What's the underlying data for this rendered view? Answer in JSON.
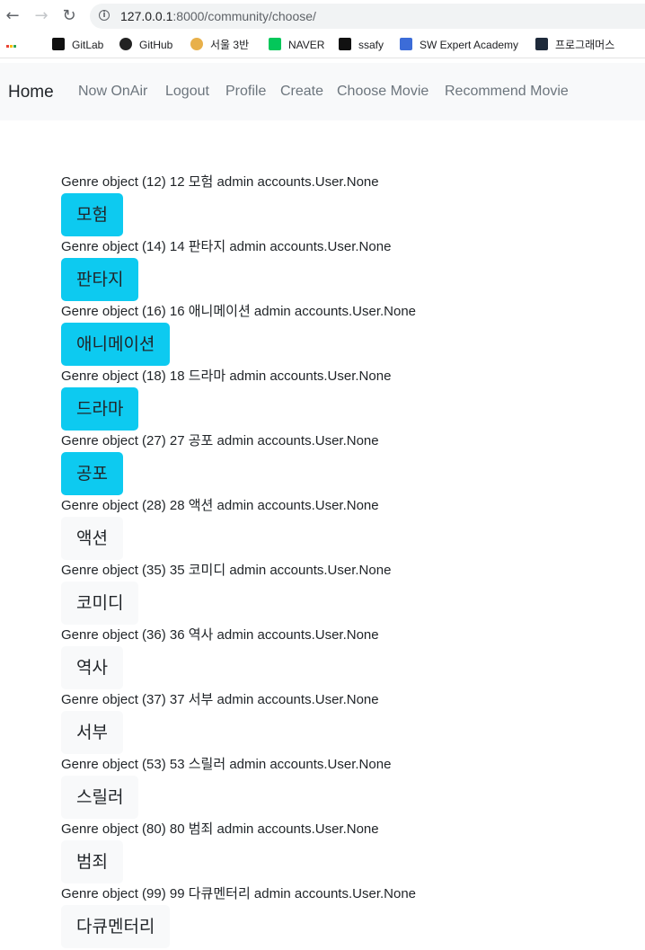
{
  "browser": {
    "url_host": "127.0.0.1",
    "url_rest": ":8000/community/choose/",
    "bookmarks": [
      {
        "label": "앱",
        "icon": "apps-icon"
      },
      {
        "label": "GitLab",
        "icon": "gitlab-icon"
      },
      {
        "label": "GitHub",
        "icon": "github-icon"
      },
      {
        "label": "서울 3반",
        "icon": "user-icon"
      },
      {
        "label": "NAVER",
        "icon": "naver-icon"
      },
      {
        "label": "ssafy",
        "icon": "ssafy-icon"
      },
      {
        "label": "SW Expert Academy",
        "icon": "swea-icon"
      },
      {
        "label": "프로그래머스",
        "icon": "programmers-icon"
      }
    ]
  },
  "navbar": {
    "brand": "Home",
    "links": [
      "Now OnAir",
      "Logout",
      "Profile",
      "Create",
      "Choose Movie",
      "Recommend Movie"
    ]
  },
  "genres": [
    {
      "text": "Genre object (12) 12 모험 admin accounts.User.None",
      "name": "모험",
      "selected": true
    },
    {
      "text": "Genre object (14) 14 판타지 admin accounts.User.None",
      "name": "판타지",
      "selected": true
    },
    {
      "text": "Genre object (16) 16 애니메이션 admin accounts.User.None",
      "name": "애니메이션",
      "selected": true
    },
    {
      "text": "Genre object (18) 18 드라마 admin accounts.User.None",
      "name": "드라마",
      "selected": true
    },
    {
      "text": "Genre object (27) 27 공포 admin accounts.User.None",
      "name": "공포",
      "selected": true
    },
    {
      "text": "Genre object (28) 28 액션 admin accounts.User.None",
      "name": "액션",
      "selected": false
    },
    {
      "text": "Genre object (35) 35 코미디 admin accounts.User.None",
      "name": "코미디",
      "selected": false
    },
    {
      "text": "Genre object (36) 36 역사 admin accounts.User.None",
      "name": "역사",
      "selected": false
    },
    {
      "text": "Genre object (37) 37 서부 admin accounts.User.None",
      "name": "서부",
      "selected": false
    },
    {
      "text": "Genre object (53) 53 스릴러 admin accounts.User.None",
      "name": "스릴러",
      "selected": false
    },
    {
      "text": "Genre object (80) 80 범죄 admin accounts.User.None",
      "name": "범죄",
      "selected": false
    },
    {
      "text": "Genre object (99) 99 다큐멘터리 admin accounts.User.None",
      "name": "다큐멘터리",
      "selected": false
    }
  ],
  "colors": {
    "selected": "#0dcaf0",
    "unselected": "#f8f9fa",
    "navbar_bg": "#f8f9fa"
  }
}
